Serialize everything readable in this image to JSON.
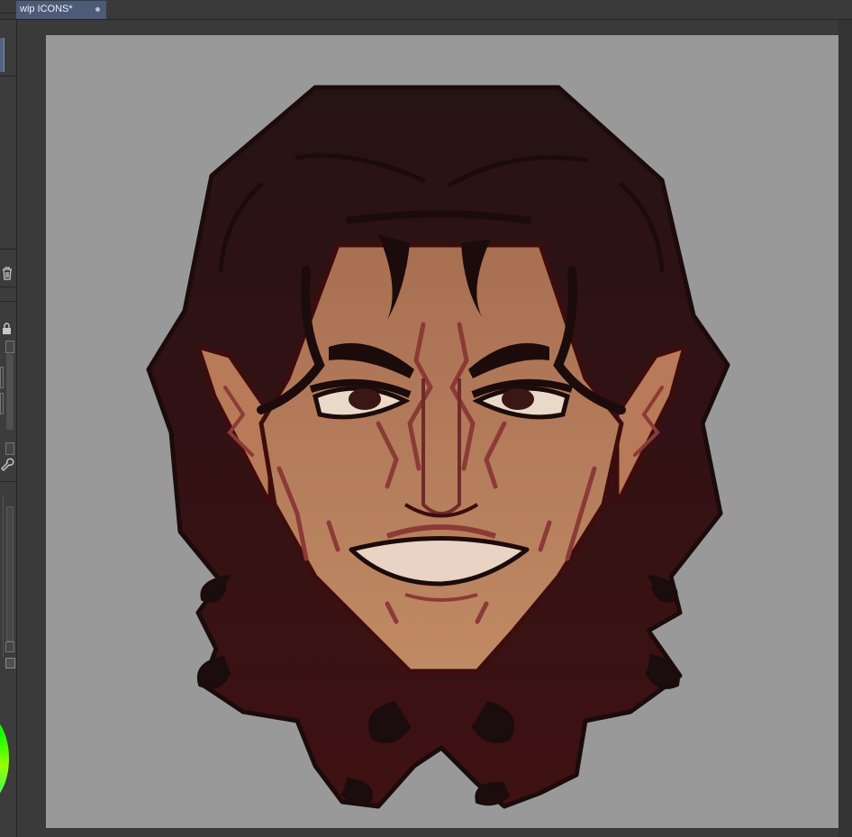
{
  "document": {
    "tab_title": "wip ICONS*"
  },
  "icons": {
    "tab_close": "close-dot-icon",
    "delete": "trash-icon",
    "lock": "lock-icon",
    "wrench": "wrench-icon"
  },
  "colors": {
    "canvas_bg": "#999999",
    "workspace_bg": "#3a3a3a",
    "tab_active": "#4d5a78",
    "hair": "#2b1315",
    "skin": "#b37a5a",
    "outline": "#3d0d0d",
    "markings": "#8c3a36"
  }
}
